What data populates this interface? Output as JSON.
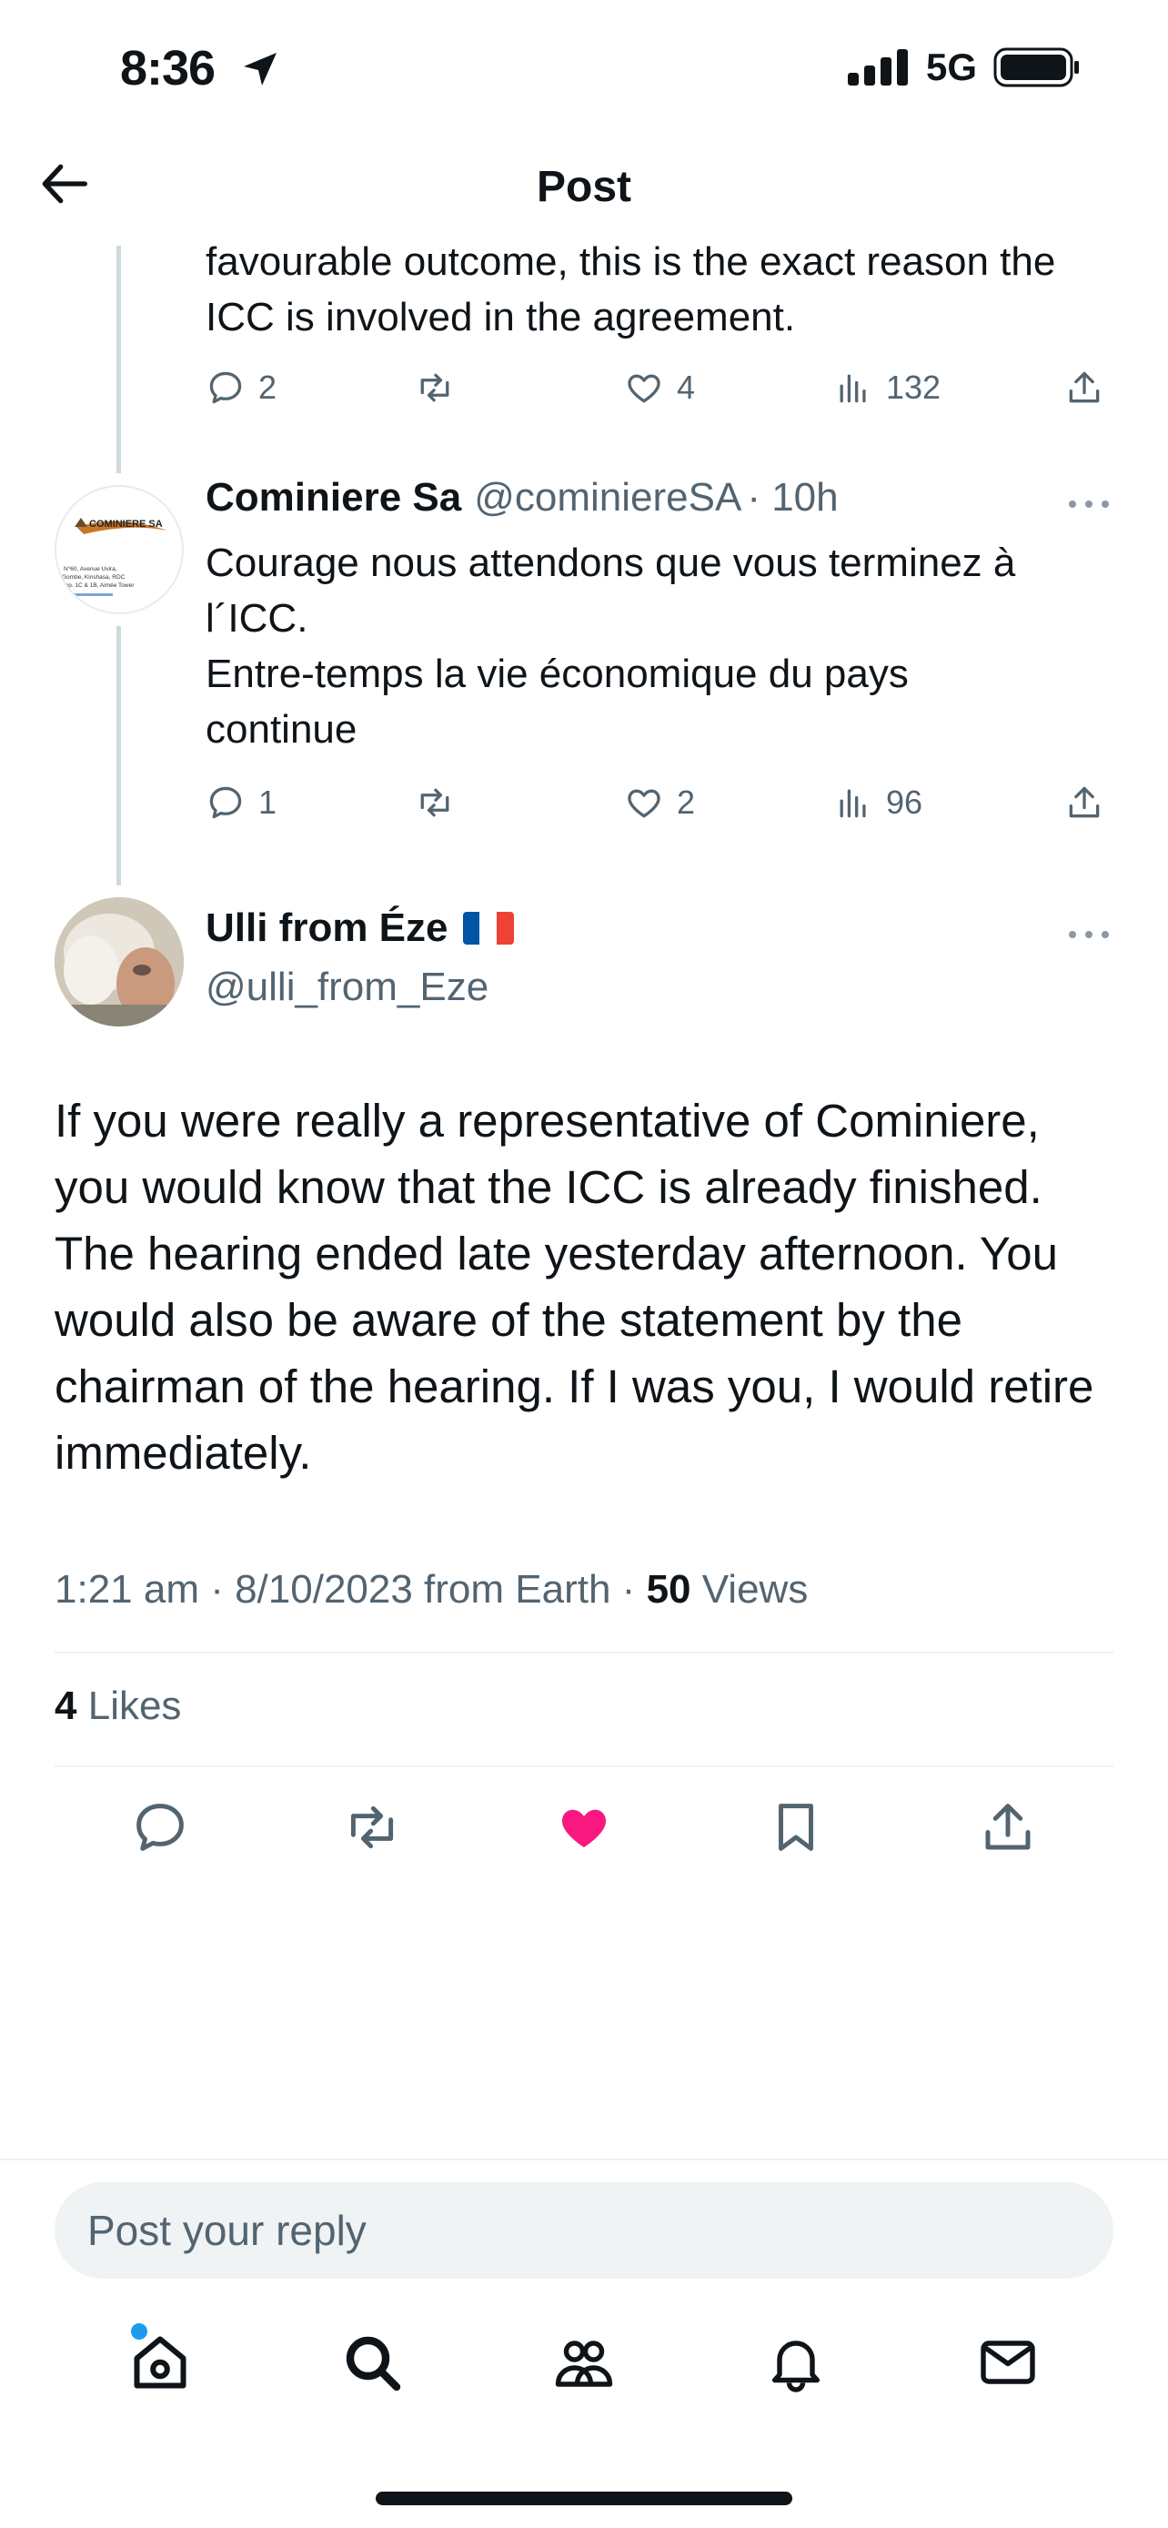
{
  "status_bar": {
    "time": "8:36",
    "network": "5G"
  },
  "header": {
    "title": "Post"
  },
  "thread": [
    {
      "text_tail": "favourable outcome, this is the exact reason the ICC is involved in the agreement.",
      "replies": "2",
      "likes": "4",
      "views": "132"
    },
    {
      "display_name": "Cominiere Sa",
      "handle": "@cominiereSA",
      "time": "· 10h",
      "avatar_label": "COMINIERE SA",
      "avatar_address": "N°60, Avenue Uvira, Gombe, Kinshasa, RDC Imp. 1C & 1B, Aimée Tower",
      "text_lines": [
        "Courage nous attendons que vous terminez à",
        "l´ICC.",
        "Entre-temps la vie économique du pays",
        "continue"
      ],
      "replies": "1",
      "likes": "2",
      "views": "96"
    }
  ],
  "main_post": {
    "display_name": "Ulli from Éze",
    "flag": "🇫🇷",
    "handle": "@ulli_from_Eze",
    "text": "If you were really a representative of Cominiere, you would know that the ICC is already finished. The hearing ended late yesterday afternoon. You would also be aware of the statement by the chairman of the hearing. If I was you, I would retire immediately.",
    "timestamp": "1:21 am · 8/10/2023 from Earth ·",
    "views_count": "50",
    "views_label": "Views",
    "likes_count": "4",
    "likes_label": "Likes"
  },
  "reply_bar": {
    "placeholder": "Post your reply"
  },
  "colors": {
    "like_pink": "#f91880",
    "accent_blue": "#1d9bf0",
    "muted": "#536471"
  },
  "icons": [
    "back-arrow-icon",
    "reply-icon",
    "retweet-icon",
    "heart-icon",
    "views-icon",
    "share-icon",
    "bookmark-icon",
    "home-icon",
    "search-icon",
    "communities-icon",
    "bell-icon",
    "mail-icon"
  ]
}
